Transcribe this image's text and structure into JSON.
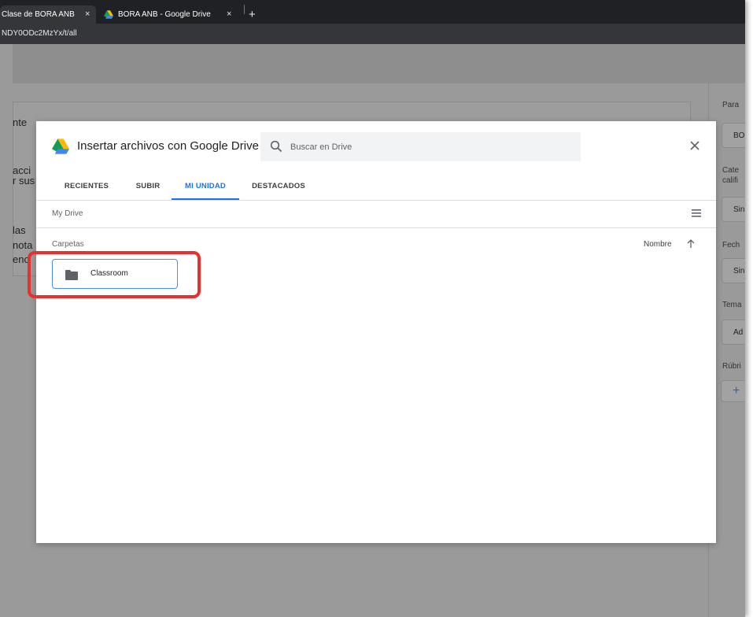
{
  "browser": {
    "tabs": [
      {
        "title": "Clase de BORA ANB",
        "close": "×"
      },
      {
        "title": "BORA ANB - Google Drive",
        "close": "×"
      }
    ],
    "new_tab": "+",
    "url": "NDY0ODc2MzYx/t/all"
  },
  "background_page": {
    "texts": [
      "nte",
      "acci",
      "r sus",
      "las",
      "nota",
      "enc"
    ],
    "right_panel": {
      "labels": [
        "Para",
        "Cate",
        "califi",
        "Fech",
        "Tema",
        "Rúbri"
      ],
      "values": [
        "BO",
        "Sin",
        "Sin",
        "Ad"
      ],
      "add": "+"
    }
  },
  "picker": {
    "title": "Insertar archivos con Google Drive",
    "search_placeholder": "Buscar en Drive",
    "close_icon": "close-icon",
    "tabs": [
      "RECIENTES",
      "SUBIR",
      "MI UNIDAD",
      "DESTACADOS"
    ],
    "active_tab": "MI UNIDAD",
    "breadcrumb": "My Drive",
    "section_label": "Carpetas",
    "sort_label": "Nombre",
    "sort_direction": "ascending",
    "folders": [
      {
        "name": "Classroom"
      }
    ]
  },
  "colors": {
    "accent": "#1a73e8",
    "highlight": "#e8302e",
    "overlay": "#9a9a9a"
  }
}
